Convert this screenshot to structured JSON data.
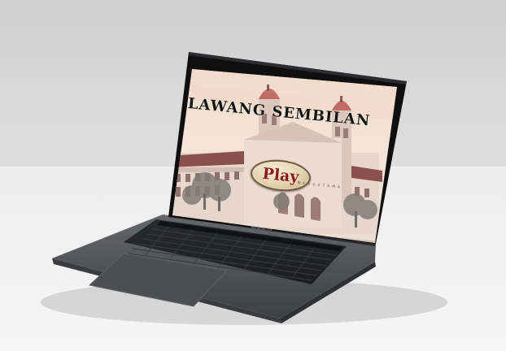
{
  "game": {
    "title": "LAWANG SEMBILAN",
    "play_label": "Play",
    "play_subtitle": "M E N U  U T A M A"
  },
  "device": {
    "brand_label": "MacBook Pro"
  },
  "colors": {
    "title_text": "#141414",
    "play_text": "#8b1a1a",
    "play_fill": "#e4d2ad",
    "sky_top": "#f3dccb",
    "building": "#e6d4c9",
    "roof": "#7a3535",
    "laptop_body": "#545559",
    "bezel": "#0f0f10"
  }
}
